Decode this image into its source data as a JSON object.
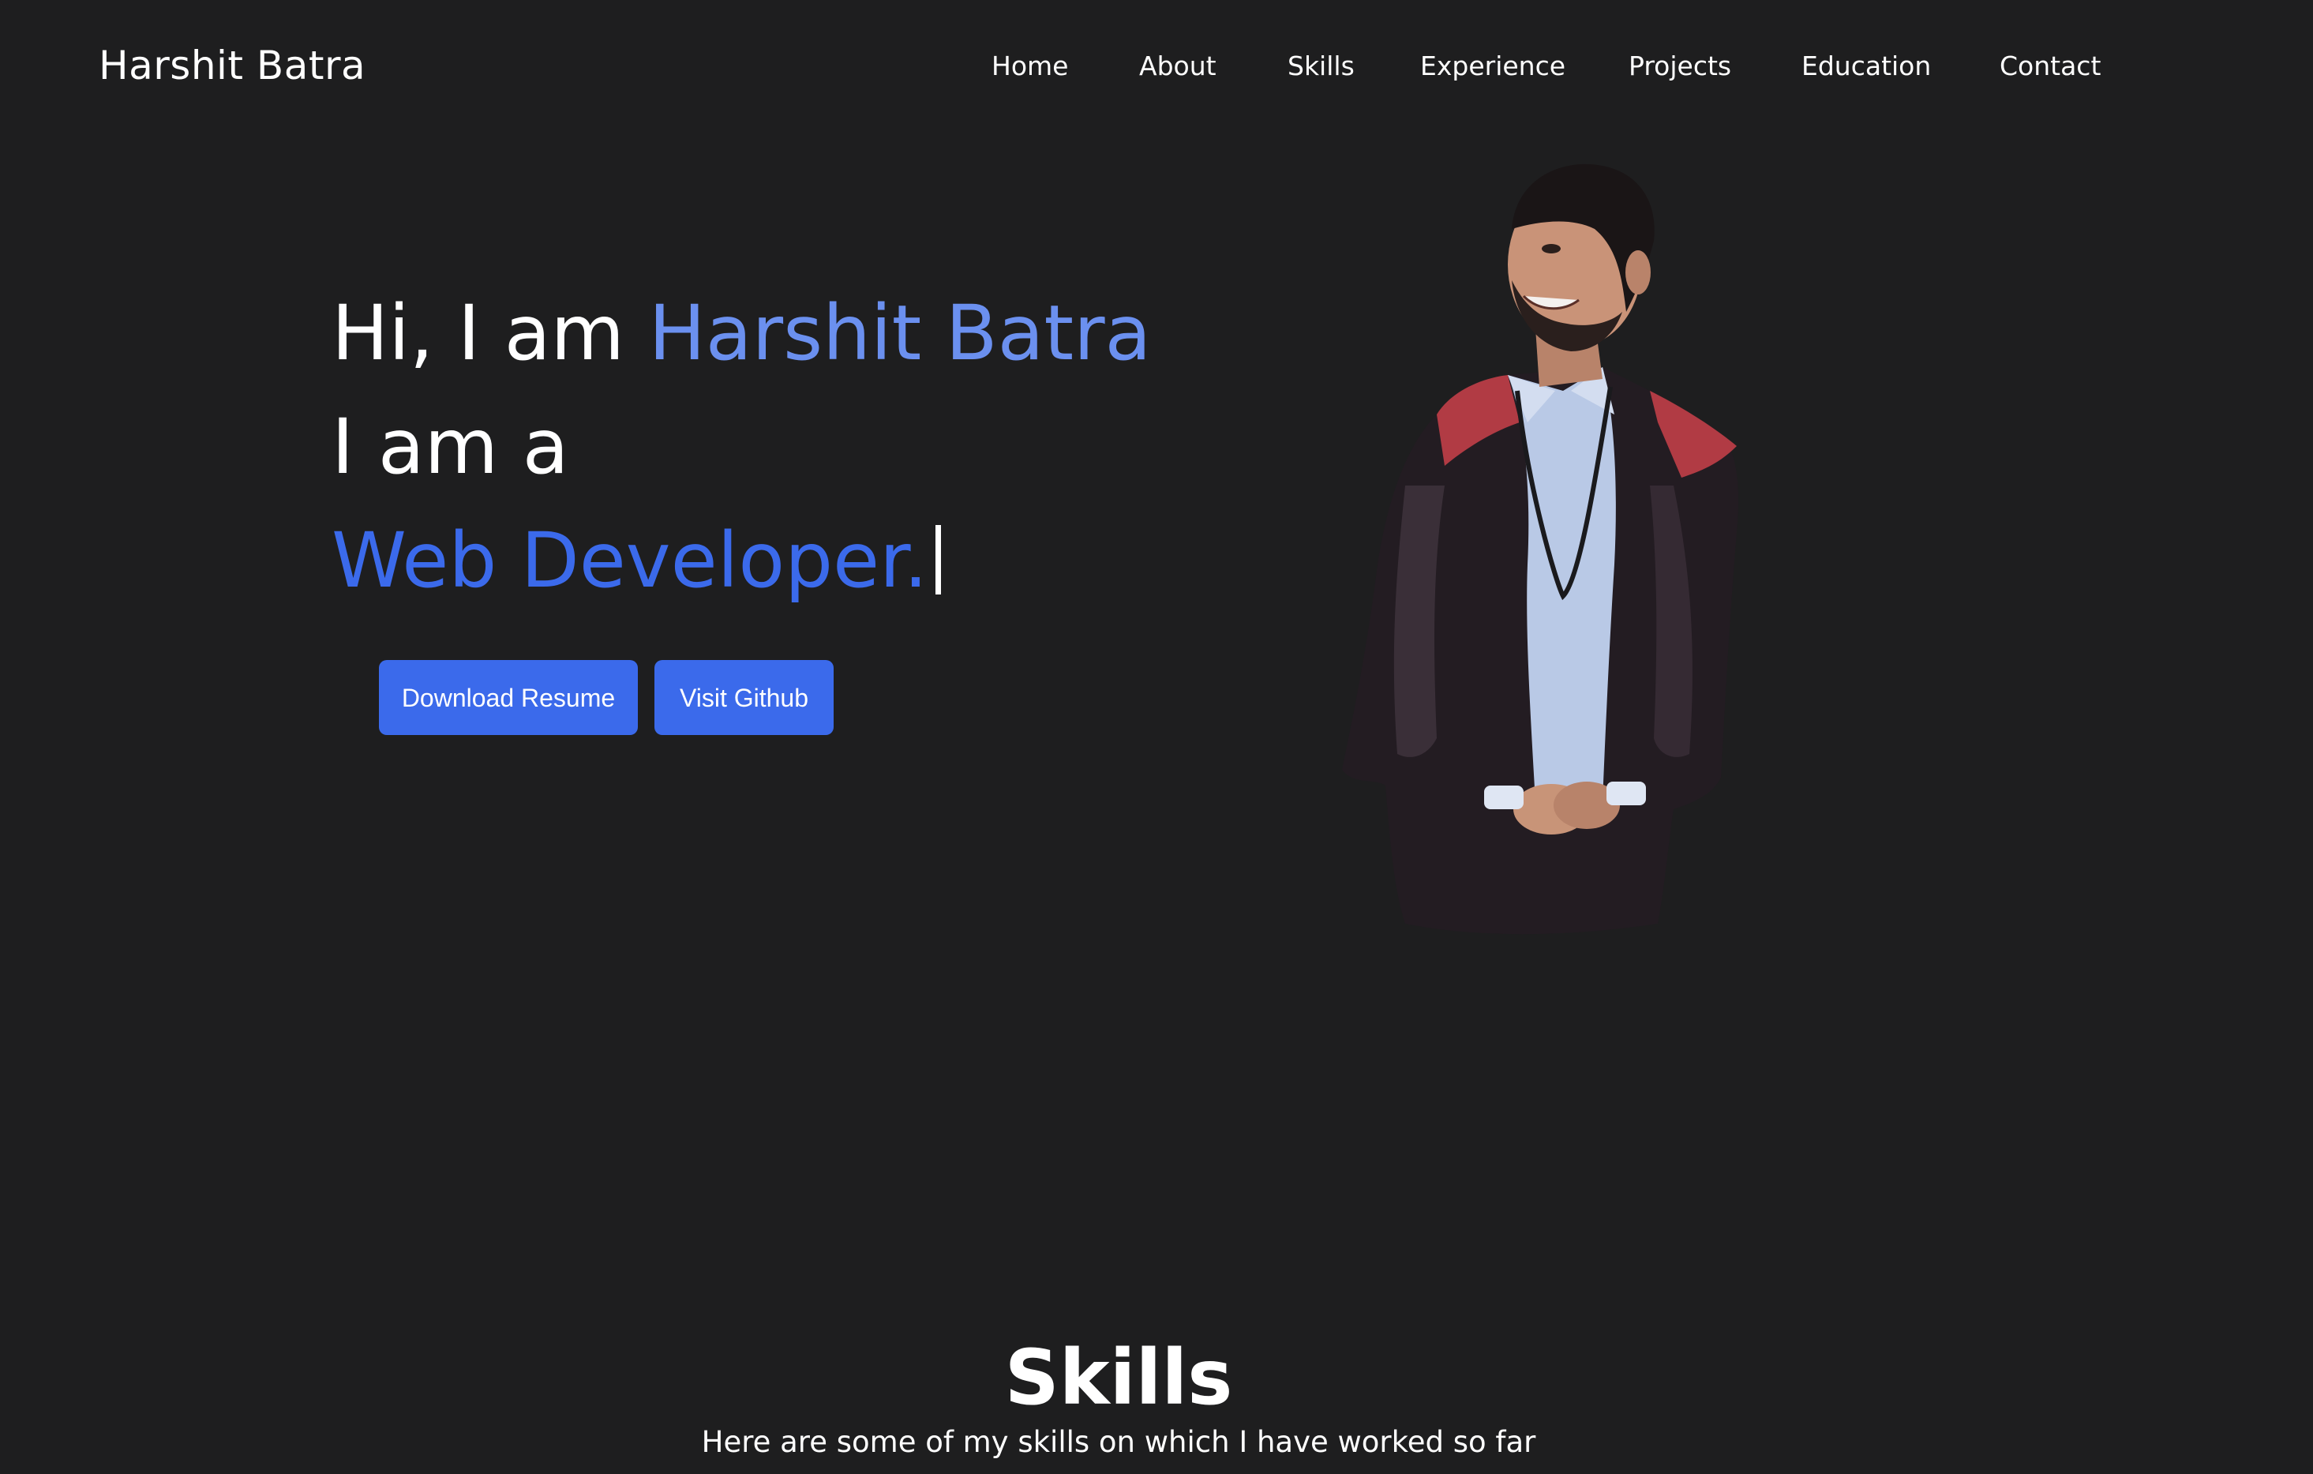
{
  "header": {
    "brand": "Harshit Batra",
    "nav": [
      {
        "label": "Home"
      },
      {
        "label": "About"
      },
      {
        "label": "Skills"
      },
      {
        "label": "Experience"
      },
      {
        "label": "Projects"
      },
      {
        "label": "Education"
      },
      {
        "label": "Contact"
      }
    ]
  },
  "hero": {
    "greeting": "Hi, I am ",
    "name": "Harshit Batra",
    "intro": "I am a",
    "role": "Web Developer.",
    "buttons": {
      "resume": "Download Resume",
      "github": "Visit Github"
    }
  },
  "skills": {
    "title": "Skills",
    "subtitle": "Here are some of my skills on which I have worked so far"
  },
  "colors": {
    "background": "#1e1e1f",
    "accent_name": "#6b90ef",
    "accent_role": "#3b6aeb",
    "button": "#3b6aeb"
  }
}
